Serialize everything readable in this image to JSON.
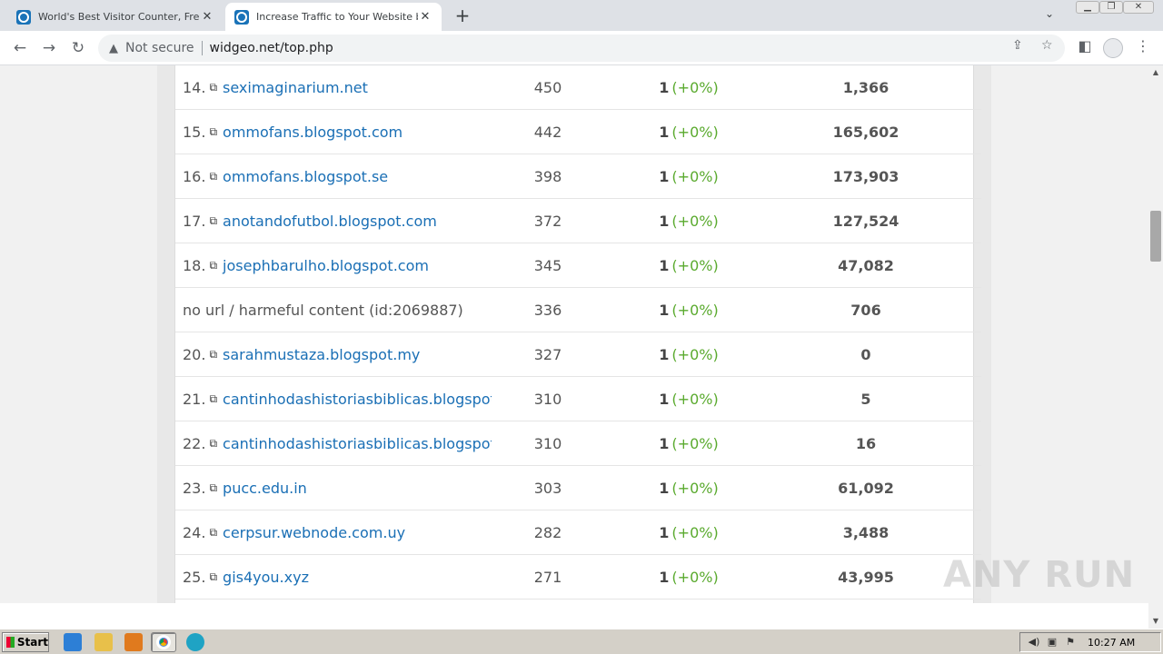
{
  "browser": {
    "tabs": [
      {
        "title": "World's Best Visitor Counter, Free hi",
        "active": false
      },
      {
        "title": "Increase Traffic to Your Website by",
        "active": true
      }
    ],
    "new_tab": "+",
    "security_label": "Not secure",
    "url": "widgeo.net/top.php"
  },
  "ranking": {
    "rows": [
      {
        "num": "14.",
        "site": "seximaginarium.net",
        "is_link": true,
        "visits": "450",
        "today": "1",
        "pct": "(+0%)",
        "total": "1,366"
      },
      {
        "num": "15.",
        "site": "ommofans.blogspot.com",
        "is_link": true,
        "visits": "442",
        "today": "1",
        "pct": "(+0%)",
        "total": "165,602"
      },
      {
        "num": "16.",
        "site": "ommofans.blogspot.se",
        "is_link": true,
        "visits": "398",
        "today": "1",
        "pct": "(+0%)",
        "total": "173,903"
      },
      {
        "num": "17.",
        "site": "anotandofutbol.blogspot.com",
        "is_link": true,
        "visits": "372",
        "today": "1",
        "pct": "(+0%)",
        "total": "127,524"
      },
      {
        "num": "18.",
        "site": "josephbarulho.blogspot.com",
        "is_link": true,
        "visits": "345",
        "today": "1",
        "pct": "(+0%)",
        "total": "47,082"
      },
      {
        "num": "",
        "site": "no url / harmeful content (id:2069887)",
        "is_link": false,
        "visits": "336",
        "today": "1",
        "pct": "(+0%)",
        "total": "706"
      },
      {
        "num": "20.",
        "site": "sarahmustaza.blogspot.my",
        "is_link": true,
        "visits": "327",
        "today": "1",
        "pct": "(+0%)",
        "total": "0"
      },
      {
        "num": "21.",
        "site": "cantinhodashistoriasbiblicas.blogspot.c",
        "is_link": true,
        "visits": "310",
        "today": "1",
        "pct": "(+0%)",
        "total": "5"
      },
      {
        "num": "22.",
        "site": "cantinhodashistoriasbiblicas.blogspot.c",
        "is_link": true,
        "visits": "310",
        "today": "1",
        "pct": "(+0%)",
        "total": "16"
      },
      {
        "num": "23.",
        "site": "pucc.edu.in",
        "is_link": true,
        "visits": "303",
        "today": "1",
        "pct": "(+0%)",
        "total": "61,092"
      },
      {
        "num": "24.",
        "site": "cerpsur.webnode.com.uy",
        "is_link": true,
        "visits": "282",
        "today": "1",
        "pct": "(+0%)",
        "total": "3,488"
      },
      {
        "num": "25.",
        "site": "gis4you.xyz",
        "is_link": true,
        "visits": "271",
        "today": "1",
        "pct": "(+0%)",
        "total": "43,995"
      }
    ]
  },
  "watermark": "ANY RUN",
  "taskbar": {
    "start_label": "Start",
    "clock": "10:27 AM"
  }
}
